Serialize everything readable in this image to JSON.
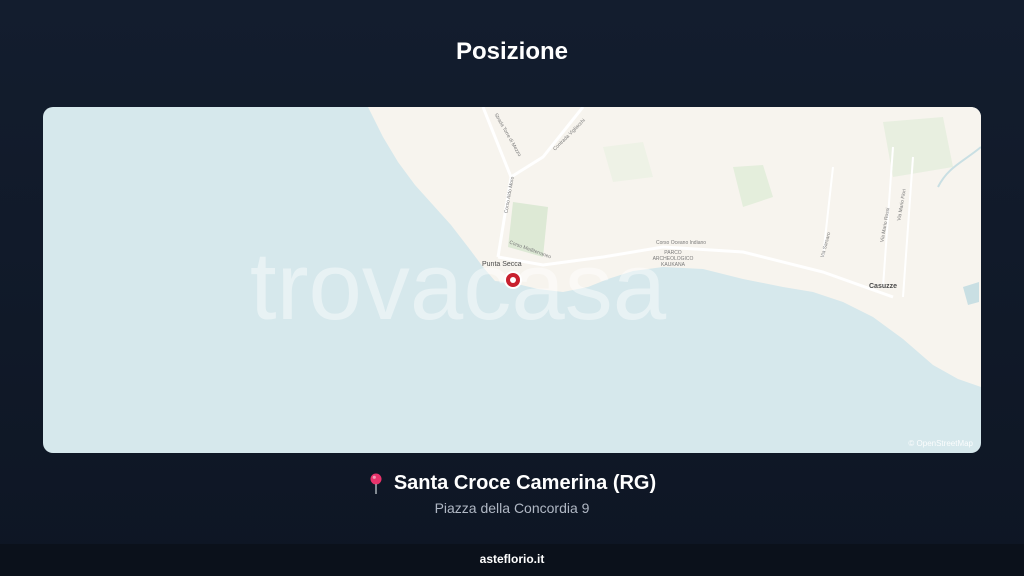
{
  "page": {
    "title": "Posizione"
  },
  "map": {
    "watermark": "trovacasa",
    "attribution": "© OpenStreetMap",
    "colors": {
      "sea": "#d6e8ec",
      "land": "#f7f4ee",
      "green": "#dde9d5",
      "marker": "#c8202e"
    },
    "labels": {
      "punta_secca": "Punta Secca",
      "casuzze": "Casuzze",
      "road_1": "Strada Torre di Mezzo",
      "road_2": "Contrada Vigliacchi",
      "road_3": "Corso Aldo Moro",
      "road_4": "Corso Mediterraneo",
      "road_5": "Corso Oceano Indiano",
      "park": "PARCO ARCHEOLOGICO KAUKANA",
      "road_6": "Via Sarsaro",
      "road_7": "Via Mario Rossi",
      "road_8": "Via Mario Fiori"
    }
  },
  "location": {
    "pin_icon": "map-pin-icon",
    "city": "Santa Croce Camerina (RG)",
    "address": "Piazza della Concordia 9"
  },
  "footer": {
    "site": "asteflorio.it"
  }
}
